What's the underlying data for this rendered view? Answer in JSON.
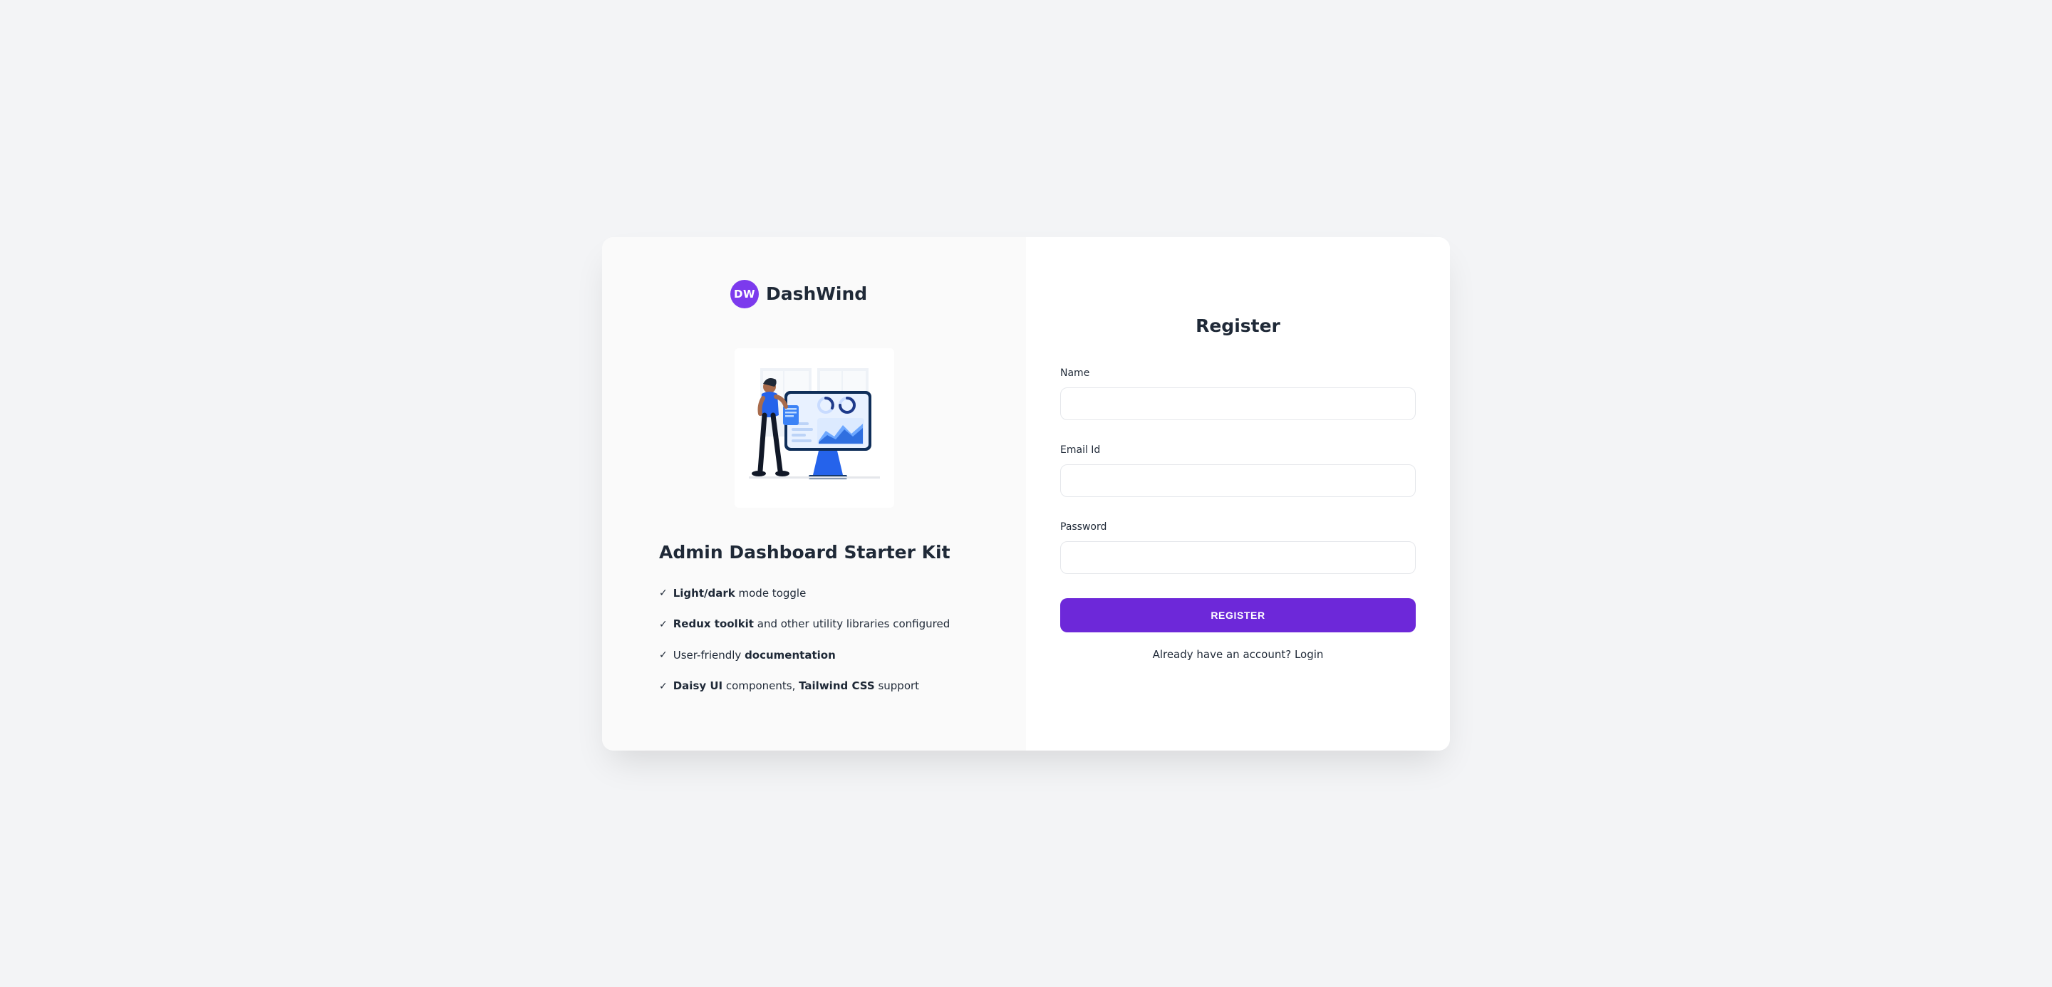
{
  "logo": {
    "mark_text": "DW",
    "brand_text": "DashWind"
  },
  "left": {
    "title": "Admin Dashboard Starter Kit",
    "features": [
      {
        "prefix_bold": "Light/dark",
        "rest": " mode toggle"
      },
      {
        "prefix_bold": "Redux toolkit",
        "rest": " and other utility libraries configured"
      },
      {
        "pretext": "User-friendly ",
        "bold": "documentation",
        "rest": ""
      },
      {
        "prefix_bold": "Daisy UI",
        "mid": " components, ",
        "bold2": "Tailwind CSS",
        "rest": " support"
      }
    ]
  },
  "form": {
    "title": "Register",
    "name_label": "Name",
    "name_value": "",
    "email_label": "Email Id",
    "email_value": "",
    "password_label": "Password",
    "password_value": "",
    "submit_label": "Register",
    "login_prompt": "Already have an account? ",
    "login_link": "Login"
  },
  "colors": {
    "primary": "#6d28d9",
    "background": "#f3f4f6",
    "text": "#1f2937"
  }
}
